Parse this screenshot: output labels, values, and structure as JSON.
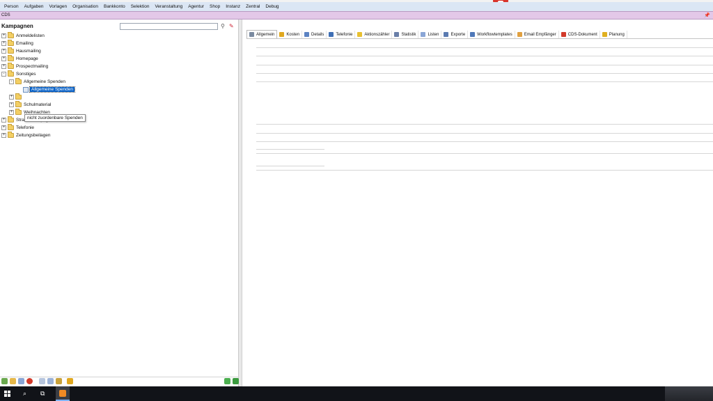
{
  "menu": [
    "Person",
    "Aufgaben",
    "Vorlagen",
    "Organisation",
    "Bankkonto",
    "Selektion",
    "Veranstaltung",
    "Agentur",
    "Shop",
    "Instanz",
    "Zentral",
    "Debug"
  ],
  "banner": {
    "label": "CDS"
  },
  "left_panel": {
    "title": "Kampagnen",
    "search_value": "",
    "tree": [
      {
        "label": "Anmeldelisten",
        "depth": 0,
        "expander": "+"
      },
      {
        "label": "Emailing",
        "depth": 0,
        "expander": "+"
      },
      {
        "label": "Hausmailing",
        "depth": 0,
        "expander": "+"
      },
      {
        "label": "Homepage",
        "depth": 0,
        "expander": "+"
      },
      {
        "label": "Prospectmailing",
        "depth": 0,
        "expander": "+"
      },
      {
        "label": "Sonstiges",
        "depth": 0,
        "expander": "-"
      },
      {
        "label": "Allgemeine Spenden",
        "depth": 1,
        "expander": "-"
      },
      {
        "label": "Allgemeine Spenden",
        "depth": 2,
        "expander": "",
        "selected": true,
        "leaf": true
      },
      {
        "label": "",
        "depth": 1,
        "expander": "+"
      },
      {
        "label": "Schulmaterial",
        "depth": 1,
        "expander": "+"
      },
      {
        "label": "Weihnachten",
        "depth": 1,
        "expander": "+"
      },
      {
        "label": "Straßenkampagnen",
        "depth": 0,
        "expander": "+"
      },
      {
        "label": "Telefonie",
        "depth": 0,
        "expander": "+"
      },
      {
        "label": "Zeitungsbeilagen",
        "depth": 0,
        "expander": "+"
      }
    ],
    "tooltip": "nicht zuordenbare Spenden"
  },
  "right_panel": {
    "tabs": [
      {
        "label": "Allgemein",
        "active": true,
        "color": "#7a8aa0"
      },
      {
        "label": "Kosten",
        "color": "#e0a820"
      },
      {
        "label": "Details",
        "color": "#5b82c2"
      },
      {
        "label": "Telefonie",
        "color": "#3f6fb5"
      },
      {
        "label": "Aktionszähler",
        "color": "#e8c030"
      },
      {
        "label": "Statistik",
        "color": "#6a7fa8"
      },
      {
        "label": "Listen",
        "color": "#8aa6d6"
      },
      {
        "label": "Exporte",
        "color": "#5a7ab0"
      },
      {
        "label": "Workflowtemplates",
        "color": "#4f78b8"
      },
      {
        "label": "Email Empfänger",
        "color": "#e0a040"
      },
      {
        "label": "CDS-Dokument",
        "color": "#d23a2a"
      },
      {
        "label": "Planung",
        "color": "#e0b020"
      }
    ]
  },
  "colors": {
    "menu_bg": "#dbe6f4",
    "banner_bg": "#e3c8e8",
    "selection": "#0a63c9",
    "taskbar": "#111318"
  }
}
